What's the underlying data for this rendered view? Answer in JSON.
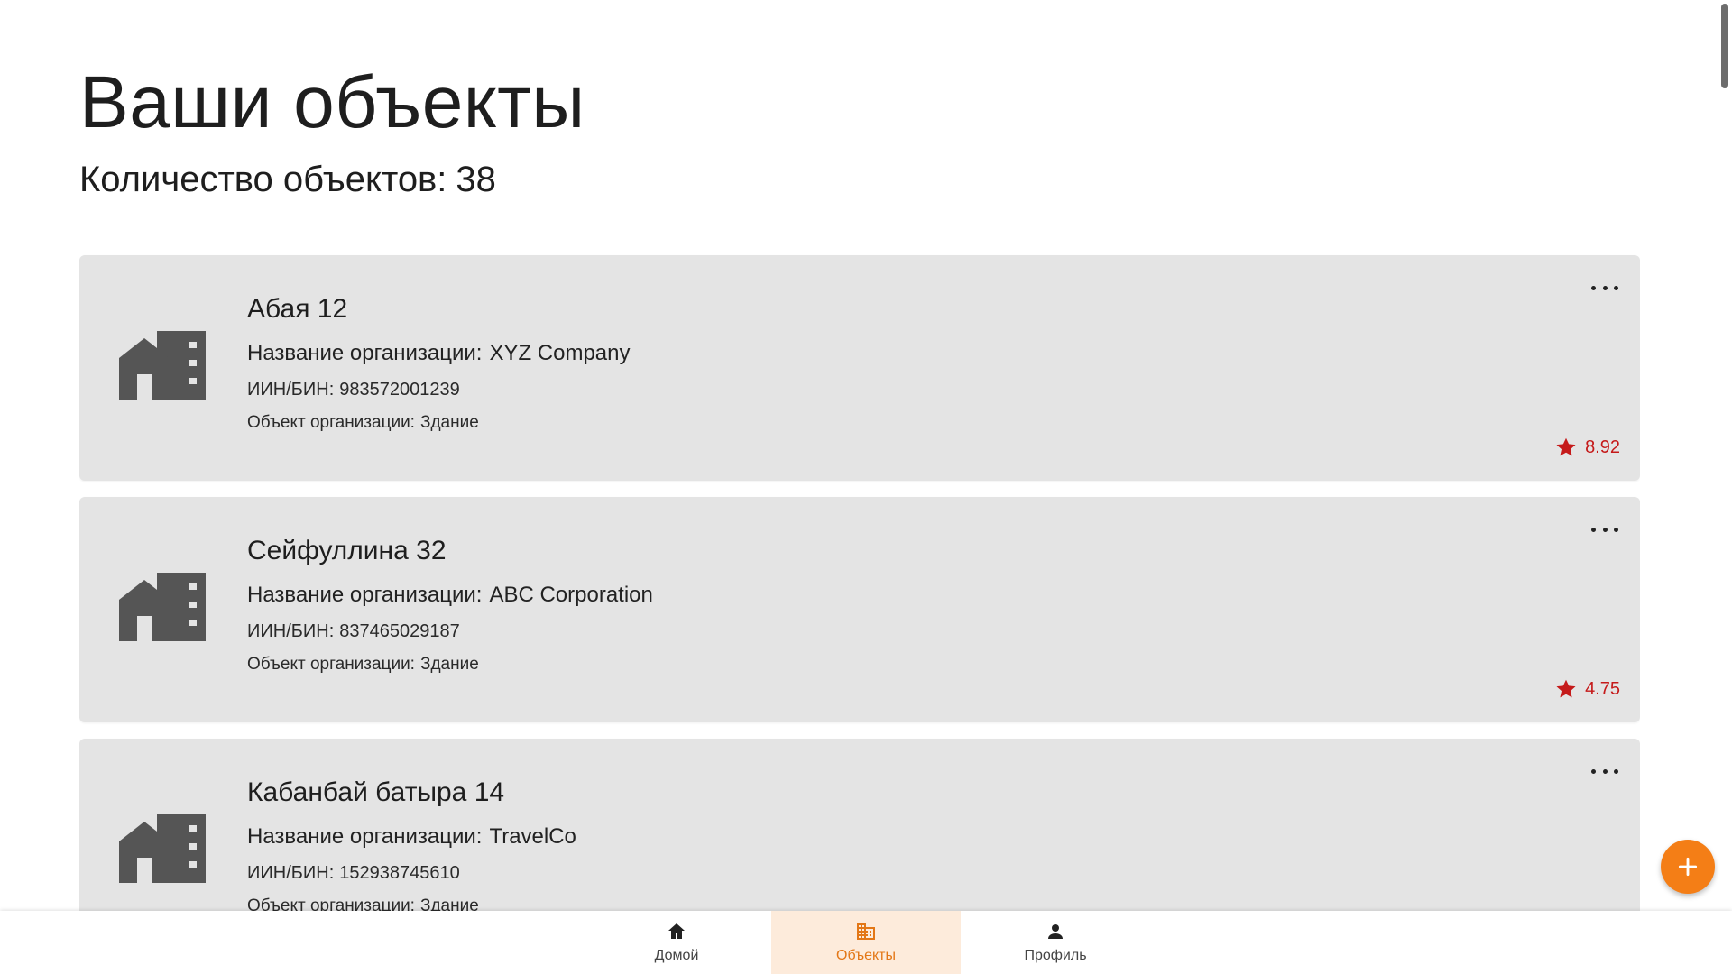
{
  "page": {
    "title": "Ваши объекты",
    "count_label": "Количество объектов:",
    "count_value": "38"
  },
  "colors": {
    "accent": "#f47e16",
    "card_bg": "#e4e4e4",
    "rating": "#c51a1a",
    "nav_active_bg": "#fdebdb"
  },
  "objects": [
    {
      "icon": "building-icon",
      "title": "Абая 12",
      "org_label": "Название организации:",
      "org_value": "XYZ Company",
      "iin_label": "ИИН/БИН:",
      "iin_value": "983572001239",
      "type_label": "Объект организации:",
      "type_value": "Здание",
      "rating": "8.92"
    },
    {
      "icon": "building-icon",
      "title": "Сейфуллина 32",
      "org_label": "Название организации:",
      "org_value": "ABC Corporation",
      "iin_label": "ИИН/БИН:",
      "iin_value": "837465029187",
      "type_label": "Объект организации:",
      "type_value": "Здание",
      "rating": "4.75"
    },
    {
      "icon": "building-icon",
      "title": "Кабанбай батыра 14",
      "org_label": "Название организации:",
      "org_value": "TravelCo",
      "iin_label": "ИИН/БИН:",
      "iin_value": "152938745610",
      "type_label": "Объект организации:",
      "type_value": "Здание",
      "rating": ""
    }
  ],
  "fab": {
    "icon": "plus-icon"
  },
  "nav": {
    "home_label": "Домой",
    "objects_label": "Объекты",
    "profile_label": "Профиль",
    "active": "objects"
  }
}
